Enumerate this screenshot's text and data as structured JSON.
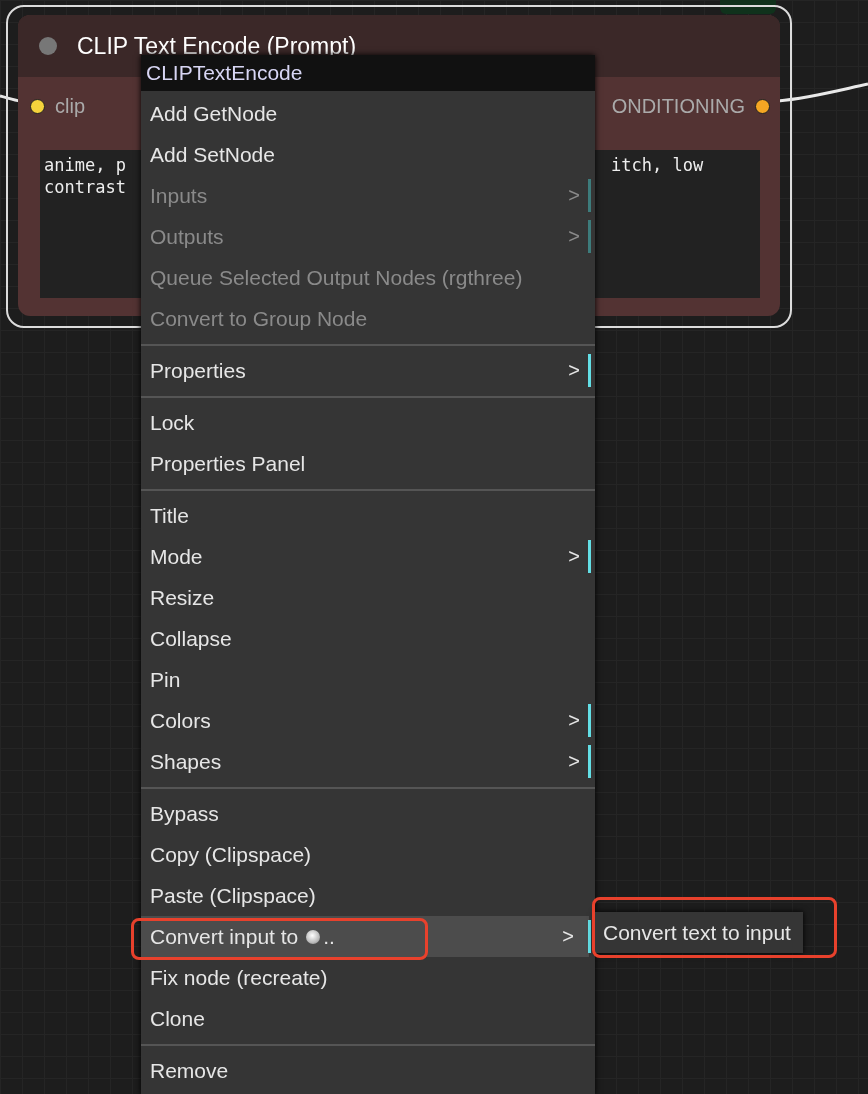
{
  "node": {
    "title": "CLIP Text Encode (Prompt)",
    "selected": true,
    "input": {
      "label": "clip",
      "color": "#f5d33c"
    },
    "output": {
      "label": "ONDITIONING",
      "color": "#f5a623"
    },
    "prompt_left": [
      "anime, p",
      "contrast"
    ],
    "prompt_right": [
      "itch, low"
    ]
  },
  "context_menu": {
    "title": "CLIPTextEncode",
    "sections": [
      [
        {
          "label": "Add GetNode",
          "disabled": false,
          "selected": false
        },
        {
          "label": "Add SetNode",
          "disabled": false,
          "selected": false
        },
        {
          "label": "Inputs",
          "disabled": true,
          "arrow": ">",
          "selected": false
        },
        {
          "label": "Outputs",
          "disabled": true,
          "arrow": ">",
          "selected": false
        },
        {
          "label": "Queue Selected Output Nodes (rgthree)",
          "disabled": true,
          "selected": false
        },
        {
          "label": "Convert to Group Node",
          "disabled": true,
          "selected": false
        }
      ],
      [
        {
          "label": "Properties",
          "disabled": false,
          "arrow": ">",
          "selected": false
        }
      ],
      [
        {
          "label": "Lock",
          "disabled": false,
          "selected": false
        },
        {
          "label": "Properties Panel",
          "disabled": false,
          "selected": false
        }
      ],
      [
        {
          "label": "Title",
          "disabled": false,
          "selected": false
        },
        {
          "label": "Mode",
          "disabled": false,
          "arrow": ">",
          "selected": false
        },
        {
          "label": "Resize",
          "disabled": false,
          "selected": false
        },
        {
          "label": "Collapse",
          "disabled": false,
          "selected": false
        },
        {
          "label": "Pin",
          "disabled": false,
          "selected": false
        },
        {
          "label": "Colors",
          "disabled": false,
          "arrow": ">",
          "selected": false
        },
        {
          "label": "Shapes",
          "disabled": false,
          "arrow": ">",
          "selected": false
        }
      ],
      [
        {
          "label": "Bypass",
          "disabled": false,
          "selected": false
        },
        {
          "label": "Copy (Clipspace)",
          "disabled": false,
          "selected": false
        },
        {
          "label": "Paste (Clipspace)",
          "disabled": false,
          "selected": false
        },
        {
          "label": "Convert input to",
          "suffix": "..",
          "disabled": false,
          "arrow": ">",
          "selected": true,
          "annotated": true
        },
        {
          "label": "Fix node (recreate)",
          "disabled": false,
          "selected": false
        },
        {
          "label": "Clone",
          "disabled": false,
          "selected": false
        }
      ],
      [
        {
          "label": "Remove",
          "disabled": false,
          "selected": false
        }
      ]
    ]
  },
  "submenu": {
    "items": [
      {
        "label": "Convert text to input",
        "annotated": true
      }
    ]
  }
}
